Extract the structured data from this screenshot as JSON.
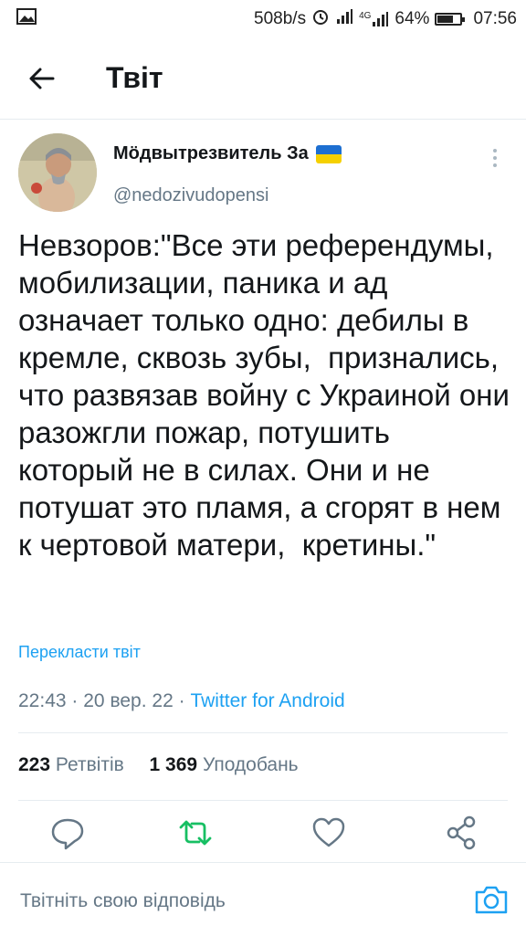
{
  "status_bar": {
    "network_speed": "508b/s",
    "network_type": "4G",
    "battery_percent": "64%",
    "battery_level": 0.64,
    "time": "07:56",
    "icons": [
      "image-icon",
      "alarm-icon",
      "signal-icon",
      "signal-4g-icon",
      "battery-icon"
    ]
  },
  "header": {
    "back_icon": "arrow-left-icon",
    "title": "Твіт"
  },
  "tweet": {
    "author_name": "Мӧдвытрезвитель За",
    "flag_icon": "ukraine-flag-icon",
    "handle": "@nedozivudopensi",
    "text": "Невзоров:\"Все эти референдумы, мобилизации, паника и ад  означает только одно: дебилы в кремле, сквозь зубы,  признались, что развязав войну с Украиной они разожгли пожар, потушить который не в силах. Они и не потушат это пламя, а сгорят в нем к чертовой матери,  кретины.\"",
    "translate_link": "Перекласти твіт",
    "time": "22:43",
    "date": "20 вер. 22",
    "separator": "·",
    "source": "Twitter for Android",
    "retweets_count": "223",
    "retweets_label": "Ретвітів",
    "likes_count": "1 369",
    "likes_label": "Уподобань"
  },
  "actions": {
    "icons": [
      "reply-icon",
      "retweet-icon",
      "like-icon",
      "share-icon"
    ],
    "retweet_color": "#17bf63",
    "icon_color": "#657786",
    "accent_color": "#1da1f2"
  },
  "reply_bar": {
    "placeholder": "Твітніть свою відповідь",
    "camera_icon": "camera-icon"
  }
}
